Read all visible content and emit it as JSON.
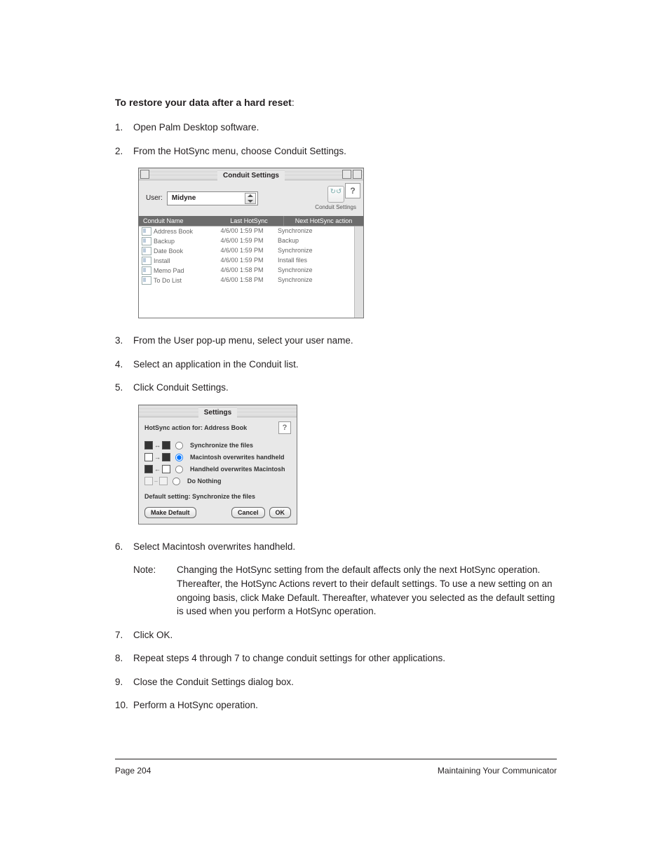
{
  "heading": {
    "bold": "To restore your data after a hard reset",
    "colon": ":"
  },
  "steps": {
    "s1": "Open Palm Desktop software.",
    "s2": "From the HotSync menu, choose Conduit Settings.",
    "s3": "From the User pop-up menu, select your user name.",
    "s4": "Select an application in the Conduit list.",
    "s5": "Click Conduit Settings.",
    "s6": "Select Macintosh overwrites handheld.",
    "s7": "Click OK.",
    "s8": "Repeat steps 4 through 7 to change conduit settings for other applications.",
    "s9": "Close the Conduit Settings dialog box.",
    "s10": "Perform a HotSync operation."
  },
  "note": {
    "label": "Note:",
    "text": "Changing the HotSync setting from the default affects only the next HotSync operation. Thereafter, the HotSync Actions revert to their default settings. To use a new setting on an ongoing basis, click Make Default. Thereafter, whatever you selected as the default setting is used when you perform a HotSync operation."
  },
  "conduit": {
    "title": "Conduit Settings",
    "user_label": "User:",
    "user_value": "Midyne",
    "tool_label": "Conduit Settings",
    "help": "?",
    "headers": {
      "c1": "Conduit Name",
      "c2": "Last HotSync",
      "c3": "Next HotSync action"
    },
    "rows": [
      {
        "name": "Address Book",
        "last": "4/6/00 1:59 PM",
        "next": "Synchronize"
      },
      {
        "name": "Backup",
        "last": "4/6/00 1:59 PM",
        "next": "Backup"
      },
      {
        "name": "Date Book",
        "last": "4/6/00 1:59 PM",
        "next": "Synchronize"
      },
      {
        "name": "Install",
        "last": "4/6/00 1:59 PM",
        "next": "Install files"
      },
      {
        "name": "Memo Pad",
        "last": "4/6/00 1:58 PM",
        "next": "Synchronize"
      },
      {
        "name": "To Do List",
        "last": "4/6/00 1:58 PM",
        "next": "Synchronize"
      }
    ]
  },
  "settings": {
    "title": "Settings",
    "subtitle": "HotSync action for:  Address Book",
    "help": "?",
    "opt1": "Synchronize the files",
    "opt2": "Macintosh overwrites handheld",
    "opt3": "Handheld overwrites Macintosh",
    "opt4": "Do Nothing",
    "default_line": "Default setting:  Synchronize the files",
    "btn_default": "Make Default",
    "btn_cancel": "Cancel",
    "btn_ok": "OK"
  },
  "footer": {
    "left": "Page 204",
    "right": "Maintaining Your Communicator"
  }
}
